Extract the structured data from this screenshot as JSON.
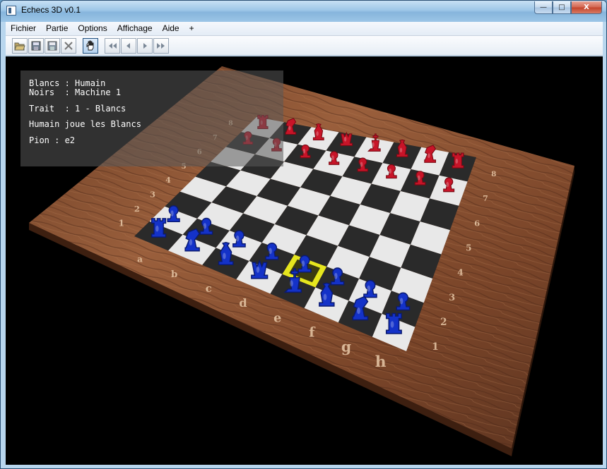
{
  "window": {
    "title": "Echecs 3D v0.1",
    "controls": {
      "minimize": "—",
      "maximize": "□",
      "close": "X"
    }
  },
  "menu": [
    "Fichier",
    "Partie",
    "Options",
    "Affichage",
    "Aide",
    "+"
  ],
  "toolbar": {
    "buttons": [
      {
        "name": "open-icon"
      },
      {
        "name": "save-icon"
      },
      {
        "name": "save-as-icon"
      },
      {
        "name": "close-doc-icon"
      },
      {
        "name": "hand-icon",
        "active": true
      },
      {
        "name": "first-move-icon"
      },
      {
        "name": "previous-move-icon"
      },
      {
        "name": "next-move-icon"
      },
      {
        "name": "last-move-icon"
      }
    ]
  },
  "overlay": {
    "line1": "Blancs : Humain",
    "line2": "Noirs  : Machine 1",
    "line3": "Trait  : 1 - Blancs",
    "line4": "Humain joue les Blancs",
    "line5": "Pion : e2"
  },
  "board": {
    "files": [
      "a",
      "b",
      "c",
      "d",
      "e",
      "f",
      "g",
      "h"
    ],
    "ranks": [
      "1",
      "2",
      "3",
      "4",
      "5",
      "6",
      "7",
      "8"
    ],
    "colors": {
      "white_player": "#1432c8",
      "black_player": "#c81428",
      "selection": "#e6e61e",
      "light_square": "#e8e8e8",
      "dark_square": "#2a2a2a",
      "wood": "#8a5030"
    },
    "selected_square": "e2"
  }
}
